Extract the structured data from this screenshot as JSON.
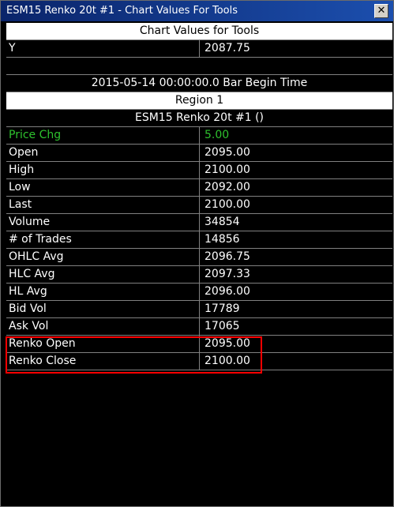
{
  "window": {
    "title": "ESM15  Renko 20t  #1 - Chart Values For Tools",
    "close_glyph": "✕"
  },
  "header": "Chart Values for Tools",
  "y_row": {
    "label": "Y",
    "value": "2087.75"
  },
  "bar_time": "2015-05-14  00:00:00.0  Bar Begin Time",
  "region": "Region 1",
  "chart_name": "ESM15  Renko 20t  #1 ()",
  "rows": [
    {
      "label": "Price Chg",
      "value": "5.00"
    },
    {
      "label": "Open",
      "value": "2095.00"
    },
    {
      "label": "High",
      "value": "2100.00"
    },
    {
      "label": "Low",
      "value": "2092.00"
    },
    {
      "label": "Last",
      "value": "2100.00"
    },
    {
      "label": "Volume",
      "value": "34854"
    },
    {
      "label": "# of Trades",
      "value": "14856"
    },
    {
      "label": "OHLC Avg",
      "value": "2096.75"
    },
    {
      "label": "HLC Avg",
      "value": "2097.33"
    },
    {
      "label": "HL Avg",
      "value": "2096.00"
    },
    {
      "label": "Bid Vol",
      "value": "17789"
    },
    {
      "label": "Ask Vol",
      "value": "17065"
    },
    {
      "label": "Renko Open",
      "value": "2095.00"
    },
    {
      "label": "Renko Close",
      "value": "2100.00"
    }
  ],
  "colors": {
    "titlebar": "#0a246a",
    "price_change": "#2ec22e",
    "highlight": "#ff0000"
  }
}
